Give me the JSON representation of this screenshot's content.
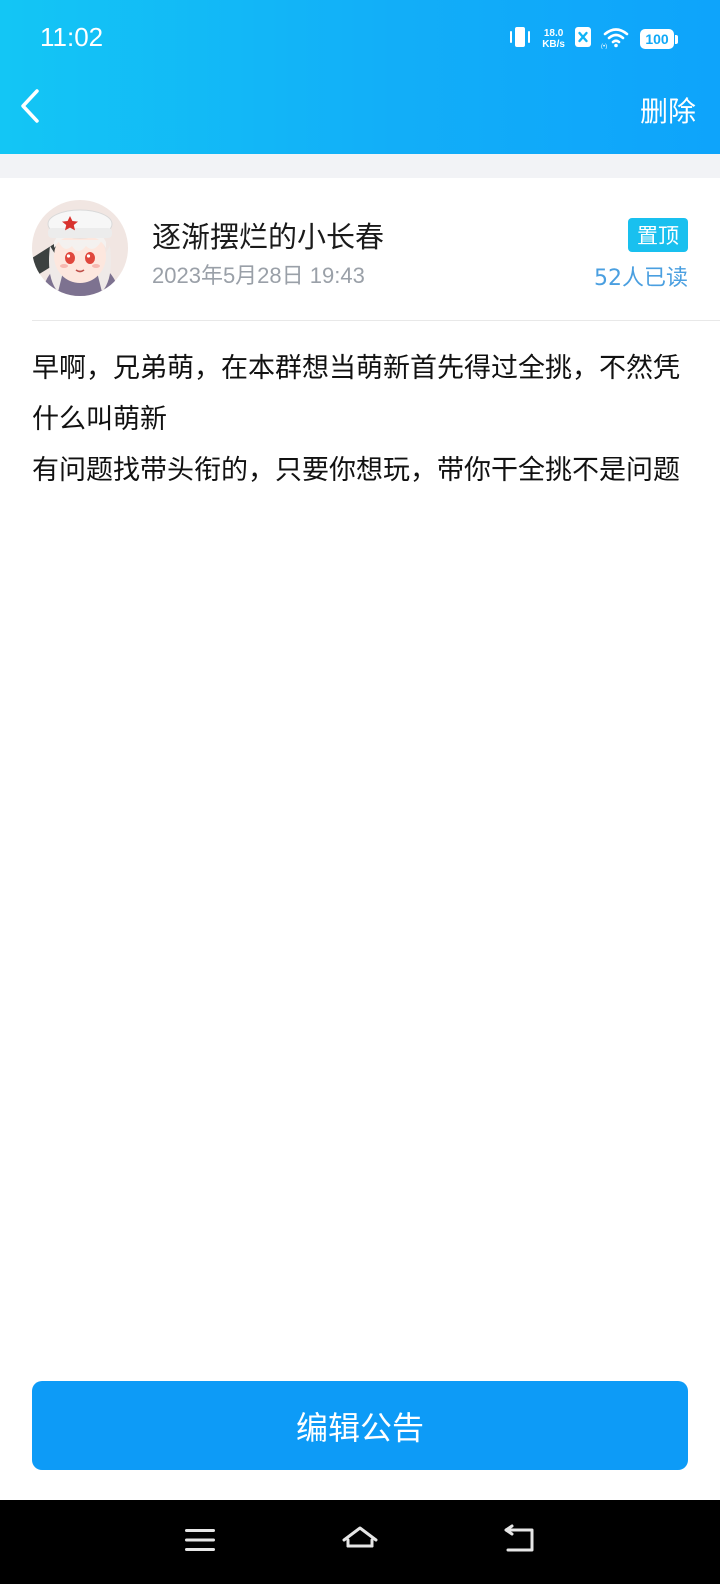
{
  "status_bar": {
    "time": "11:02",
    "net_speed_value": "18.0",
    "net_speed_unit": "KB/s",
    "battery": "100",
    "icons": [
      "vibrate-icon",
      "data-blocked-icon",
      "wifi-icon",
      "battery-icon"
    ]
  },
  "nav": {
    "back_icon": "chevron-left-icon",
    "delete_label": "删除"
  },
  "post": {
    "author": "逐渐摆烂的小长春",
    "date": "2023年5月28日 19:43",
    "pinned_label": "置顶",
    "read_count": "52人已读",
    "content": "早啊，兄弟萌，在本群想当萌新首先得过全挑，不然凭什么叫萌新\n有问题找带头衔的，只要你想玩，带你干全挑不是问题"
  },
  "edit_button_label": "编辑公告",
  "colors": {
    "header_gradient_start": "#13c6f5",
    "header_gradient_end": "#0ea4fb",
    "primary_button": "#0d9bf7",
    "pin_badge": "#19c0ef",
    "read_count": "#4a9fe0"
  },
  "system_nav": {
    "icons": [
      "menu-icon",
      "home-icon",
      "back-icon"
    ]
  }
}
